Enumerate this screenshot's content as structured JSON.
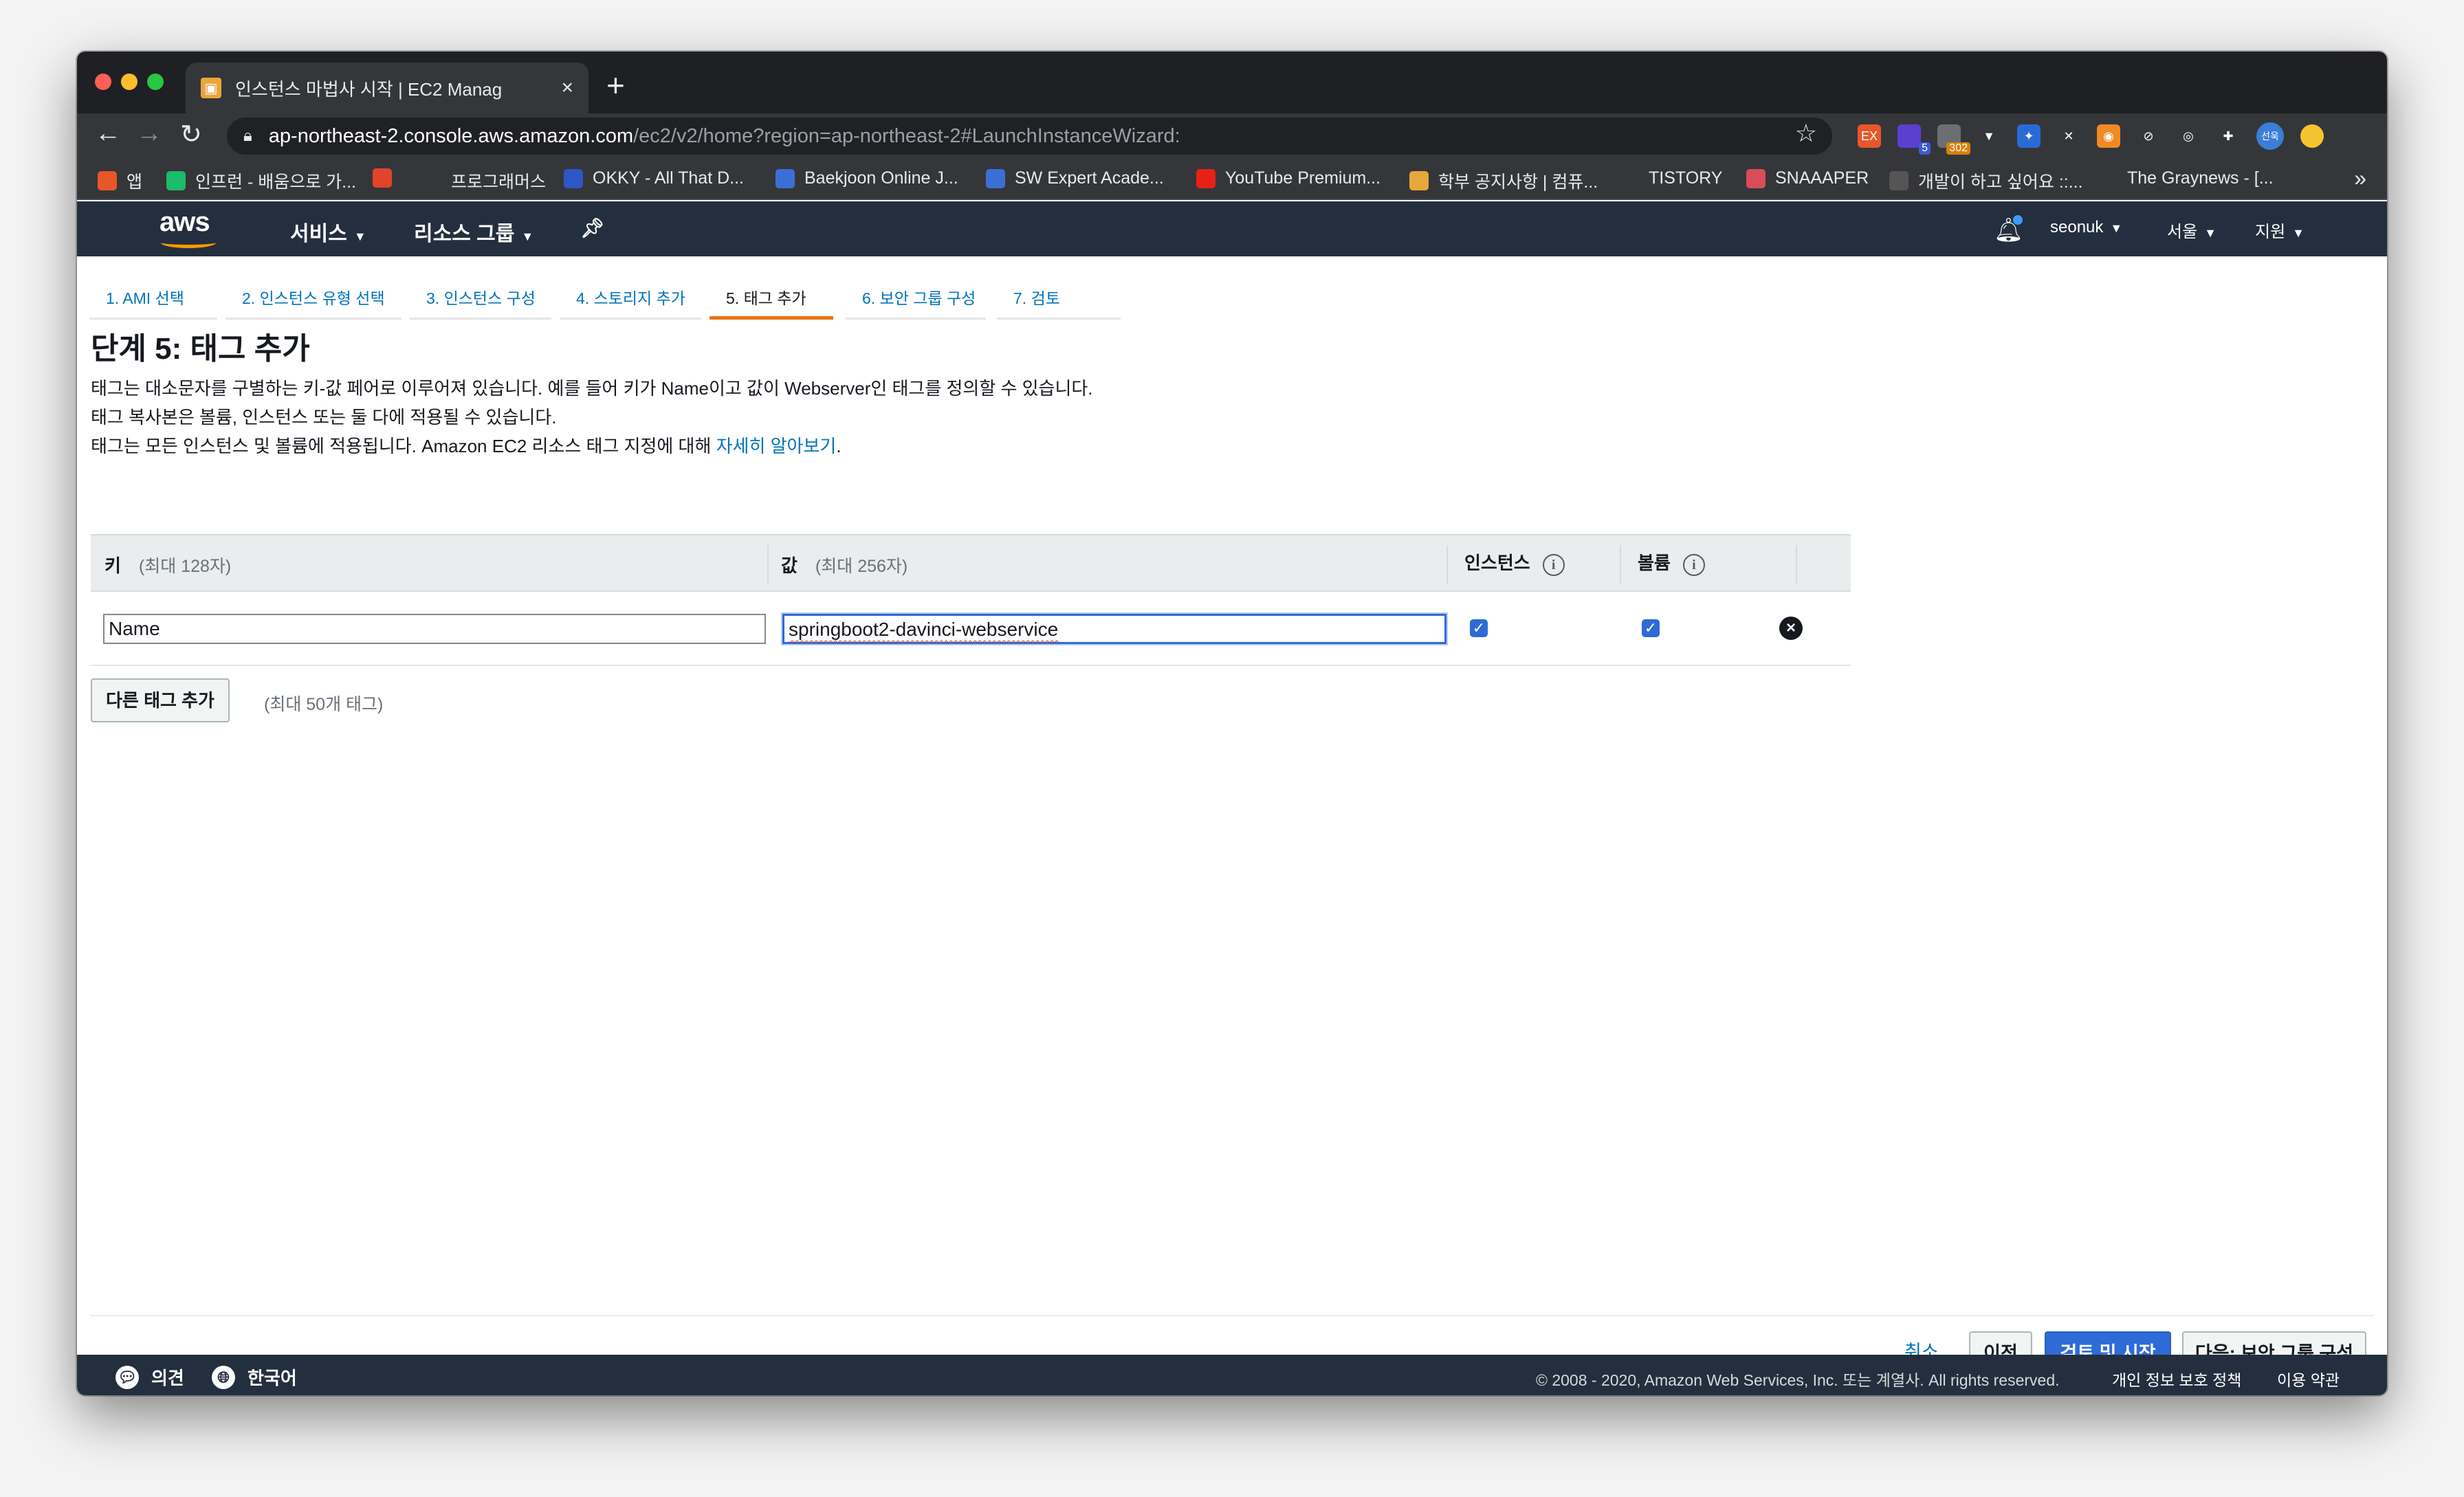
{
  "browser": {
    "tab_title": "인스턴스 마법사 시작 | EC2 Manag",
    "tab_close": "×",
    "new_tab": "+",
    "url_host": "ap-northeast-2.console.aws.amazon.com",
    "url_path": "/ec2/v2/home?region=ap-northeast-2#LaunchInstanceWizard:",
    "extensions": [
      {
        "icon": "ex-extension-icon",
        "label": "EX",
        "color": "#e8562a"
      },
      {
        "icon": "purple-extension-icon",
        "label": "",
        "color": "#5b3fd1",
        "badge": "5",
        "badge_color": "#3b5bd6"
      },
      {
        "icon": "extension-302-icon",
        "label": "",
        "color": "#6b6f74",
        "badge": "302",
        "badge_color": "#d9820b"
      },
      {
        "icon": "vue-devtools-icon",
        "label": "▼",
        "color": "#35363a"
      },
      {
        "icon": "blue-extension-icon",
        "label": "✦",
        "color": "#2a6ad6"
      },
      {
        "icon": "x-extension-icon",
        "label": "✕",
        "color": "#35363a"
      },
      {
        "icon": "rss-icon",
        "label": "◉",
        "color": "#f08a24"
      },
      {
        "icon": "disabled-extension-icon",
        "label": "⊘",
        "color": "#35363a"
      },
      {
        "icon": "target-extension-icon",
        "label": "◎",
        "color": "#35363a"
      },
      {
        "icon": "puzzle-icon",
        "label": "✚",
        "color": "#35363a"
      }
    ],
    "profile_label": "선욱",
    "bookmarks": [
      {
        "icon": "apps-icon",
        "label": "앱",
        "color": "#e8562a"
      },
      {
        "icon": "inflearn-icon",
        "label": "인프런 - 배움으로 가...",
        "color": "#1bbc6b"
      },
      {
        "icon": "red-extension-icon",
        "label": "",
        "color": "#e0452b"
      },
      {
        "icon": "programmers-icon",
        "label": "프로그래머스",
        "color": "#35363a"
      },
      {
        "icon": "okky-icon",
        "label": "OKKY - All That D...",
        "color": "#2f56c6"
      },
      {
        "icon": "baekjoon-icon",
        "label": "Baekjoon Online J...",
        "color": "#3b6fd6"
      },
      {
        "icon": "swexpert-icon",
        "label": "SW Expert Acade...",
        "color": "#3b6fd6"
      },
      {
        "icon": "youtube-icon",
        "label": "YouTube Premium...",
        "color": "#e62117"
      },
      {
        "icon": "school-icon",
        "label": "학부 공지사항 | 컴퓨...",
        "color": "#e8a73b"
      },
      {
        "icon": "tistory-icon",
        "label": "TISTORY",
        "color": "#35363a"
      },
      {
        "icon": "snaaaper-icon",
        "label": "SNAAAPER",
        "color": "#d94c5a"
      },
      {
        "icon": "dev-blog-icon",
        "label": "개발이 하고 싶어요 ::...",
        "color": "#555"
      },
      {
        "icon": "globe-icon",
        "label": "The Graynews - [...",
        "color": "#35363a"
      }
    ],
    "bookmarks_more": "»"
  },
  "aws_header": {
    "logo": "aws",
    "services": "서비스",
    "resource_groups": "리소스 그룹",
    "user": "seonuk",
    "region": "서울",
    "support": "지원"
  },
  "wizard": {
    "steps": [
      {
        "label": "1. AMI 선택"
      },
      {
        "label": "2. 인스턴스 유형 선택"
      },
      {
        "label": "3. 인스턴스 구성"
      },
      {
        "label": "4. 스토리지 추가"
      },
      {
        "label": "5. 태그 추가"
      },
      {
        "label": "6. 보안 그룹 구성"
      },
      {
        "label": "7. 검토"
      }
    ],
    "active_step": 5,
    "title": "단계 5: 태그 추가",
    "desc1": "태그는 대소문자를 구별하는 키-값 페어로 이루어져 있습니다. 예를 들어 키가 Name이고 값이 Webserver인 태그를 정의할 수 있습니다.",
    "desc2": "태그 복사본은 볼륨, 인스턴스 또는 둘 다에 적용될 수 있습니다.",
    "desc3": "태그는 모든 인스턴스 및 볼륨에 적용됩니다. Amazon EC2 리소스 태그 지정에 대해",
    "learn_more": "자세히 알아보기",
    "desc3_end": ".",
    "table": {
      "col_key": "키",
      "col_key_hint": "(최대 128자)",
      "col_value": "값",
      "col_value_hint": "(최대 256자)",
      "col_instance": "인스턴스",
      "col_volume": "볼륨",
      "info": "i",
      "rows": [
        {
          "key": "Name",
          "value": "springboot2-davinci-webservice",
          "instance": true,
          "volume": true
        }
      ]
    },
    "add_tag": "다른 태그 추가",
    "add_tag_hint": "(최대 50개 태그)",
    "buttons": {
      "cancel": "취소",
      "previous": "이전",
      "review_launch": "검토 및 시작",
      "next": "다음: 보안 그룹 구성"
    }
  },
  "console_footer": {
    "feedback": "의견",
    "language": "한국어",
    "copyright": "© 2008 - 2020, Amazon Web Services, Inc. 또는 계열사. All rights reserved.",
    "privacy": "개인 정보 보호 정책",
    "terms": "이용 약관"
  }
}
